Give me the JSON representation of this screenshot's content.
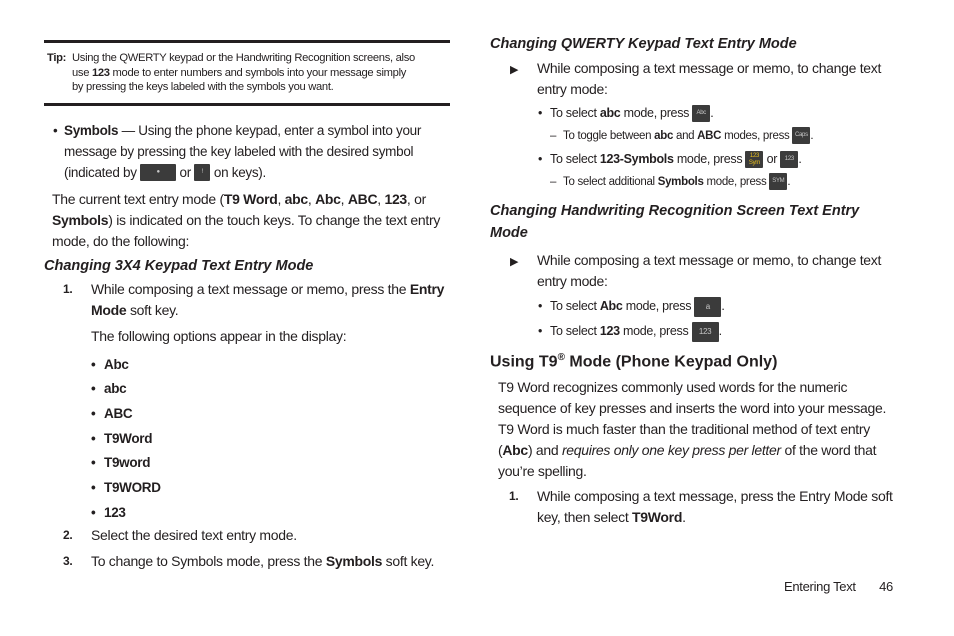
{
  "tip": {
    "label": "Tip:",
    "line1": "Using the QWERTY keypad or the Handwriting Recognition screens, also",
    "line2_pre": "use ",
    "line2_bold": "123",
    "line2_post": " mode to enter numbers and symbols into your message simply",
    "line3": "by pressing the keys labeled with the symbols you want."
  },
  "symbols_bullet": {
    "term": "Symbols",
    "text": " — Using the phone keypad, enter a symbol into your message by pressing the key labeled with the desired symbol (indicated by ",
    "or": " or ",
    "end": " on keys)."
  },
  "current_mode": {
    "t1": "The current text entry mode (",
    "m1": "T9 Word",
    "c1": ", ",
    "m2": "abc",
    "c2": ", ",
    "m3": "Abc",
    "c3": ", ",
    "m4": "ABC",
    "c4": ", ",
    "m5": "123",
    "c5": ", or ",
    "m6": "Symbols",
    "t2": ") is indicated on the touch keys. To change the text entry mode, do the following:"
  },
  "section_3x4": {
    "heading": "Changing 3X4 Keypad Text Entry Mode",
    "steps": [
      {
        "num": "1.",
        "pre": "While composing a text message or memo, press the ",
        "bold": "Entry Mode",
        "post": " soft key."
      },
      {
        "num": "2.",
        "pre": "Select the desired text entry mode.",
        "bold": "",
        "post": ""
      },
      {
        "num": "3.",
        "pre": "To change to Symbols mode, press the ",
        "bold": "Symbols",
        "post": " soft key."
      }
    ],
    "options_intro": "The following options appear in the display:",
    "options": [
      "Abc",
      "abc",
      "ABC",
      "T9Word",
      "T9word",
      "T9WORD",
      "123"
    ]
  },
  "section_qwerty": {
    "heading": "Changing QWERTY Keypad Text Entry Mode",
    "intro": "While composing a text message or memo, to change text entry mode:",
    "items": [
      {
        "type": "bullet",
        "pre": "To select ",
        "bold": "abc",
        "post": " mode, press ",
        "key": "Abc",
        "tail": "."
      },
      {
        "type": "dash",
        "pre": "To toggle between ",
        "bold": "abc",
        "mid": " and ",
        "bold2": "ABC",
        "post": " modes, press ",
        "key": "Caps",
        "tail": "."
      },
      {
        "type": "bullet",
        "pre": "To select ",
        "bold": "123-Symbols",
        "post": " mode, press ",
        "key": "123 Sym",
        "or": " or ",
        "key2": "123",
        "tail": "."
      },
      {
        "type": "dash",
        "pre": "To select additional ",
        "bold": "Symbols",
        "post": " mode, press ",
        "key": "SYM",
        "tail": "."
      }
    ]
  },
  "section_handwriting": {
    "heading": "Changing Handwriting Recognition Screen Text Entry Mode",
    "intro": "While composing a text message or memo, to change text entry mode:",
    "items": [
      {
        "pre": "To select ",
        "bold": "Abc",
        "post": " mode, press ",
        "key": "a",
        "tail": "."
      },
      {
        "pre": "To select ",
        "bold": "123",
        "post": " mode, press ",
        "key": "123",
        "tail": "."
      }
    ]
  },
  "section_t9": {
    "heading_pre": "Using T9",
    "heading_sup": "®",
    "heading_post": " Mode (Phone Keypad Only)",
    "p1": "T9 Word recognizes commonly used words for the numeric sequence of key presses and inserts the word into your message.",
    "p2_pre": "T9 Word is much faster than the traditional method of text entry (",
    "p2_bold": "Abc",
    "p2_mid": ") and ",
    "p2_italic": "requires only one key press per letter",
    "p2_post": " of the word that you’re spelling.",
    "step": {
      "num": "1.",
      "pre": "While composing a text message, press the Entry Mode soft key, then select ",
      "bold": "T9Word",
      "post": "."
    }
  },
  "footer": {
    "section": "Entering Text",
    "page": "46"
  },
  "icons": {
    "arrow": "▶",
    "bullet": "•",
    "dash": "–",
    "exclaim_key": "!"
  }
}
